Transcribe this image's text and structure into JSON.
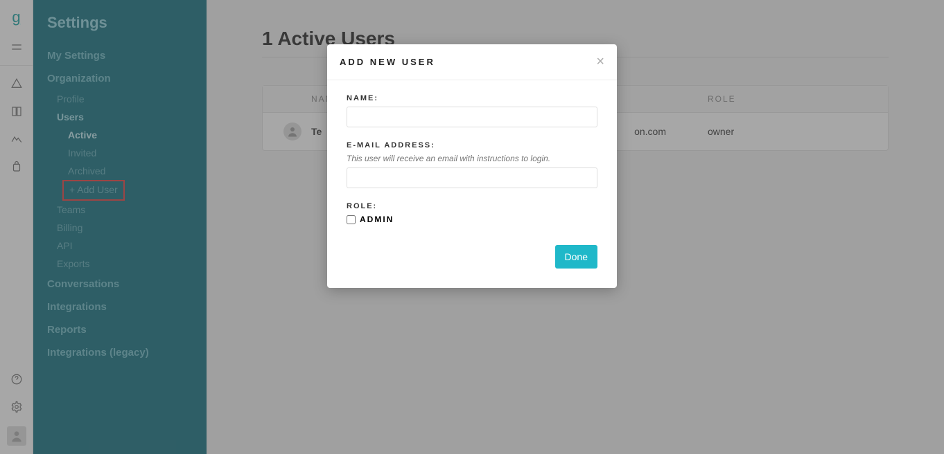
{
  "sidebar": {
    "title": "Settings",
    "my_settings": "My Settings",
    "organization": "Organization",
    "org_items": {
      "profile": "Profile",
      "users": "Users",
      "users_sub": {
        "active": "Active",
        "invited": "Invited",
        "archived": "Archived",
        "add_user": "+ Add User"
      },
      "teams": "Teams",
      "billing": "Billing",
      "api": "API",
      "exports": "Exports"
    },
    "conversations": "Conversations",
    "integrations": "Integrations",
    "reports": "Reports",
    "integrations_legacy": "Integrations (legacy)"
  },
  "main": {
    "heading": "1 Active Users",
    "table": {
      "headers": {
        "name": "NAME",
        "role": "ROLE"
      },
      "rows": [
        {
          "name": "Te",
          "email_fragment": "on.com",
          "role": "owner"
        }
      ]
    }
  },
  "modal": {
    "title": "ADD NEW USER",
    "name_label": "NAME:",
    "email_label": "E-MAIL ADDRESS:",
    "email_helper": "This user will receive an email with instructions to login.",
    "role_label": "ROLE:",
    "admin_label": "ADMIN",
    "done": "Done"
  }
}
